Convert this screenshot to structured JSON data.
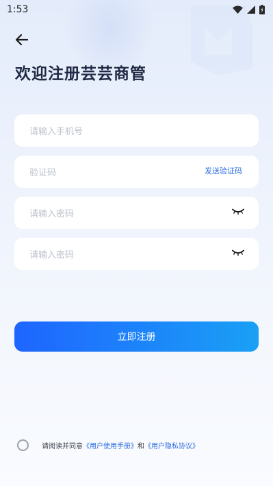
{
  "status_bar": {
    "time": "1:53",
    "icons": [
      "wifi-icon",
      "cellular-signal-icon",
      "battery-icon"
    ]
  },
  "header": {
    "back_icon": "arrow-left-icon",
    "title": "欢迎注册芸芸商管"
  },
  "form": {
    "phone_placeholder": "请输入手机号",
    "code_placeholder": "验证码",
    "send_code_label": "发送验证码",
    "password_placeholder": "请输入密码",
    "confirm_password_placeholder": "请输入密码",
    "eye_icon": "eye-closed-icon"
  },
  "register_button_label": "立即注册",
  "agreement": {
    "prefix": "请阅读并同意",
    "manual_link": "《用户使用手册》",
    "conjunction": "和",
    "privacy_link": "《用户隐私协议》",
    "checked": false
  },
  "colors": {
    "accent": "#2f6fe0",
    "button_start": "#1f65ff",
    "button_end": "#1aa0f5",
    "title": "#1f2a44"
  }
}
